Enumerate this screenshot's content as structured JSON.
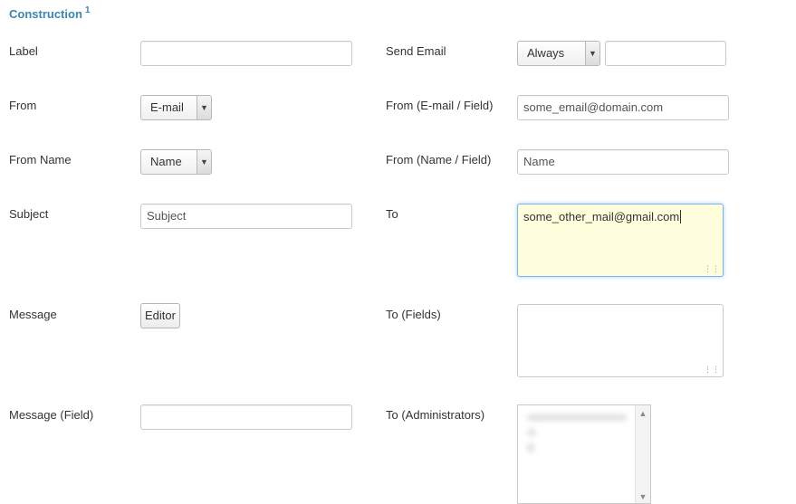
{
  "section": {
    "title": "Construction",
    "title_sup": "1"
  },
  "left": {
    "label": {
      "label": "Label",
      "value": ""
    },
    "from": {
      "label": "From",
      "selected": "E-mail"
    },
    "from_name": {
      "label": "From Name",
      "selected": "Name"
    },
    "subject": {
      "label": "Subject",
      "value": "Subject"
    },
    "message": {
      "label": "Message",
      "button": "Editor"
    },
    "message_field": {
      "label": "Message (Field)",
      "value": ""
    }
  },
  "right": {
    "send_email": {
      "label": "Send Email",
      "selected": "Always",
      "value": ""
    },
    "from_email_field": {
      "label": "From (E-mail / Field)",
      "value": "some_email@domain.com"
    },
    "from_name_field": {
      "label": "From (Name / Field)",
      "value": "Name"
    },
    "to": {
      "label": "To",
      "value": "some_other_mail@gmail.com"
    },
    "to_fields": {
      "label": "To (Fields)",
      "value": ""
    },
    "to_administrators": {
      "label": "To (Administrators)"
    }
  },
  "icons": {
    "dropdown": "chevron-down-icon",
    "resize": "resize-grip-icon",
    "scroll_up": "scroll-up-icon",
    "scroll_down": "scroll-down-icon"
  },
  "colors": {
    "accent": "#3a87ad",
    "focus_bg": "#ffffdd",
    "focus_border": "#7fb3e0"
  }
}
